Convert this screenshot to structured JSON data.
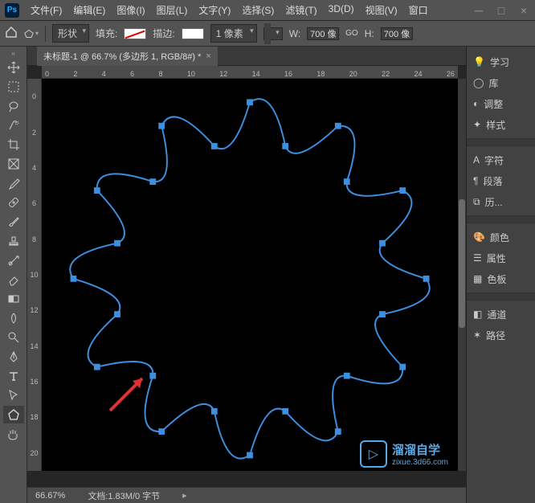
{
  "menu": {
    "file": "文件(F)",
    "edit": "编辑(E)",
    "image": "图像(I)",
    "layer": "图层(L)",
    "type": "文字(Y)",
    "select": "选择(S)",
    "filter": "滤镜(T)",
    "threed": "3D(D)",
    "view": "视图(V)",
    "window": "窗口"
  },
  "options": {
    "mode": "形状",
    "fill_label": "填充:",
    "stroke_label": "描边:",
    "stroke_width": "1 像素",
    "w_label": "W:",
    "w_value": "700 像",
    "link": "GO",
    "h_label": "H:",
    "h_value": "700 像"
  },
  "doc": {
    "tab_title": "未标题-1 @ 66.7% (多边形 1, RGB/8#) *"
  },
  "ruler_h": [
    "0",
    "2",
    "4",
    "6",
    "8",
    "10",
    "12",
    "14",
    "16",
    "18",
    "20",
    "22",
    "24",
    "26"
  ],
  "ruler_v": [
    "0",
    "2",
    "4",
    "6",
    "8",
    "10",
    "12",
    "14",
    "16",
    "18",
    "20"
  ],
  "status": {
    "zoom": "66.67%",
    "doc_info": "文档:1.83M/0 字节"
  },
  "panels": {
    "learn": "学习",
    "library": "库",
    "adjust": "调整",
    "styles": "样式",
    "char": "字符",
    "para": "段落",
    "history": "历...",
    "color": "颜色",
    "props": "属性",
    "swatches": "色板",
    "channels": "通道",
    "paths": "路径"
  },
  "watermark": {
    "line1": "溜溜自学",
    "line2": "zixue.3d66.com"
  },
  "icons": {
    "home": "home-icon",
    "polygon": "polygon-icon"
  }
}
